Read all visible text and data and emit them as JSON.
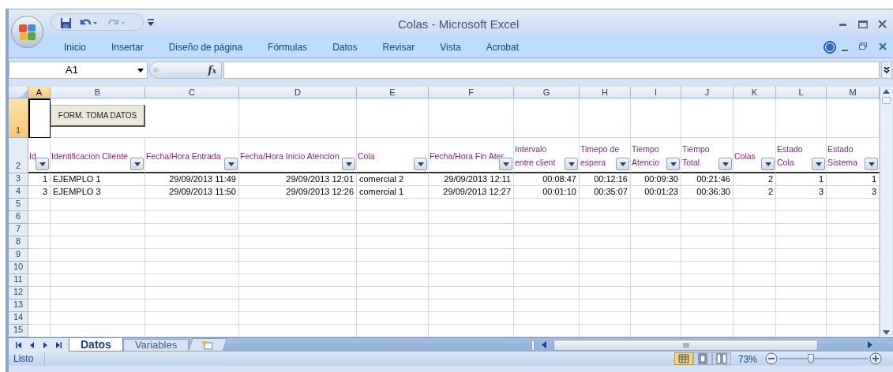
{
  "window": {
    "title": "Colas - Microsoft Excel"
  },
  "ribbon": {
    "tabs": [
      "Inicio",
      "Insertar",
      "Diseño de página",
      "Fórmulas",
      "Datos",
      "Revisar",
      "Vista",
      "Acrobat"
    ]
  },
  "formula_bar": {
    "name_box": "A1",
    "fx": "fx"
  },
  "columns": [
    {
      "letter": "A",
      "selected": true,
      "kind": "number"
    },
    {
      "letter": "B",
      "selected": false,
      "kind": "text"
    },
    {
      "letter": "C",
      "selected": false,
      "kind": "number"
    },
    {
      "letter": "D",
      "selected": false,
      "kind": "number"
    },
    {
      "letter": "E",
      "selected": false,
      "kind": "text"
    },
    {
      "letter": "F",
      "selected": false,
      "kind": "number"
    },
    {
      "letter": "G",
      "selected": false,
      "kind": "number"
    },
    {
      "letter": "H",
      "selected": false,
      "kind": "number"
    },
    {
      "letter": "I",
      "selected": false,
      "kind": "number"
    },
    {
      "letter": "J",
      "selected": false,
      "kind": "number"
    },
    {
      "letter": "K",
      "selected": false,
      "kind": "number"
    },
    {
      "letter": "L",
      "selected": false,
      "kind": "number"
    },
    {
      "letter": "M",
      "selected": false,
      "kind": "number"
    }
  ],
  "form_button": "FORM. TOMA DATOS",
  "header_row": {
    "number": "2",
    "cells": [
      {
        "lines": [
          "Id"
        ]
      },
      {
        "lines": [
          "Identificacion Cliente"
        ]
      },
      {
        "lines": [
          "Fecha/Hora Entrada"
        ]
      },
      {
        "lines": [
          "Fecha/Hora Inicio Atencion"
        ]
      },
      {
        "lines": [
          "Cola"
        ]
      },
      {
        "lines": [
          "Fecha/Hora Fin Ater"
        ]
      },
      {
        "lines": [
          "Intervalo",
          "entre client"
        ]
      },
      {
        "lines": [
          "Timepo de",
          "espera"
        ]
      },
      {
        "lines": [
          "Tiempo",
          "Atencio"
        ]
      },
      {
        "lines": [
          "Tiempo",
          "Total"
        ]
      },
      {
        "lines": [
          "Colas"
        ]
      },
      {
        "lines": [
          "Estado",
          "Cola"
        ]
      },
      {
        "lines": [
          "Estado",
          "Sistema"
        ]
      }
    ]
  },
  "rows": [
    {
      "number": "1",
      "selected": true,
      "cells": []
    },
    {
      "number": "3",
      "selected": false,
      "cells": [
        "1",
        "EJEMPLO 1",
        "29/09/2013 11:49",
        "29/09/2013 12:01",
        "comercial 2",
        "29/09/2013 12:11",
        "00:08:47",
        "00:12:16",
        "00:09:30",
        "00:21:46",
        "2",
        "1",
        "1"
      ]
    },
    {
      "number": "4",
      "selected": false,
      "cells": [
        "3",
        "EJEMPLO 3",
        "29/09/2013 11:50",
        "29/09/2013 12:26",
        "comercial 1",
        "29/09/2013 12:27",
        "00:01:10",
        "00:35:07",
        "00:01:23",
        "00:36:30",
        "2",
        "3",
        "3"
      ]
    },
    {
      "number": "5",
      "selected": false,
      "cells": []
    },
    {
      "number": "6",
      "selected": false,
      "cells": []
    },
    {
      "number": "7",
      "selected": false,
      "cells": []
    },
    {
      "number": "8",
      "selected": false,
      "cells": []
    },
    {
      "number": "9",
      "selected": false,
      "cells": []
    },
    {
      "number": "10",
      "selected": false,
      "cells": []
    },
    {
      "number": "11",
      "selected": false,
      "cells": []
    },
    {
      "number": "12",
      "selected": false,
      "cells": []
    },
    {
      "number": "13",
      "selected": false,
      "cells": []
    },
    {
      "number": "14",
      "selected": false,
      "cells": []
    },
    {
      "number": "15",
      "selected": false,
      "cells": []
    }
  ],
  "sheet_tabs": [
    {
      "label": "Datos",
      "selected": true
    },
    {
      "label": "Variables",
      "selected": false
    }
  ],
  "status_bar": {
    "text": "Listo",
    "views": [
      {
        "kind": "normal",
        "selected": true
      },
      {
        "kind": "layout",
        "selected": false
      },
      {
        "kind": "pagebreak",
        "selected": false
      }
    ],
    "zoom": "73%",
    "zoom_slider": {
      "level": 0.36
    }
  }
}
